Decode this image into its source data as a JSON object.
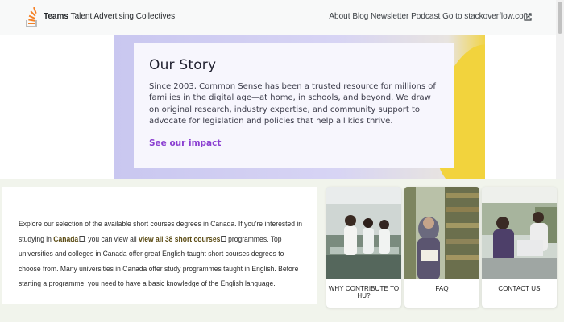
{
  "header": {
    "brand": [
      "Teams",
      "Talent",
      "Advertising",
      "Collectives"
    ],
    "nav": [
      "About",
      "Blog",
      "Newsletter",
      "Podcast",
      "Go to stackoverflow.com"
    ]
  },
  "hero": {
    "title": "Our Story",
    "text": "Since 2003, Common Sense has been a trusted resource for millions of families in the digital age—at home, in schools, and beyond. We draw on original research, industry expertise, and community support to advocate for legislation and policies that help all kids thrive.",
    "link": "See our impact"
  },
  "info": {
    "p1": "Explore our selection of the available short courses degrees in Canada. If you're interested in studying in",
    "link1": "Canada",
    "p2": ", you can view all",
    "link2": "view all 38 short courses",
    "p3": "programmes. Top universities and colleges in Canada offer great English-taught short courses degrees to choose from. Many universities in Canada offer study programmes taught in English. Before starting a programme, you need to have a basic knowledge of the English language."
  },
  "cards": [
    {
      "label": "WHY CONTRIBUTE TO HU?",
      "icon": "lab-photo"
    },
    {
      "label": "FAQ",
      "icon": "library-photo"
    },
    {
      "label": "CONTACT US",
      "icon": "study-photo"
    }
  ],
  "colors": {
    "brand_orange": "#f48024",
    "hero_link": "#8b3fd1",
    "hero_yellow": "#f2d33d"
  }
}
